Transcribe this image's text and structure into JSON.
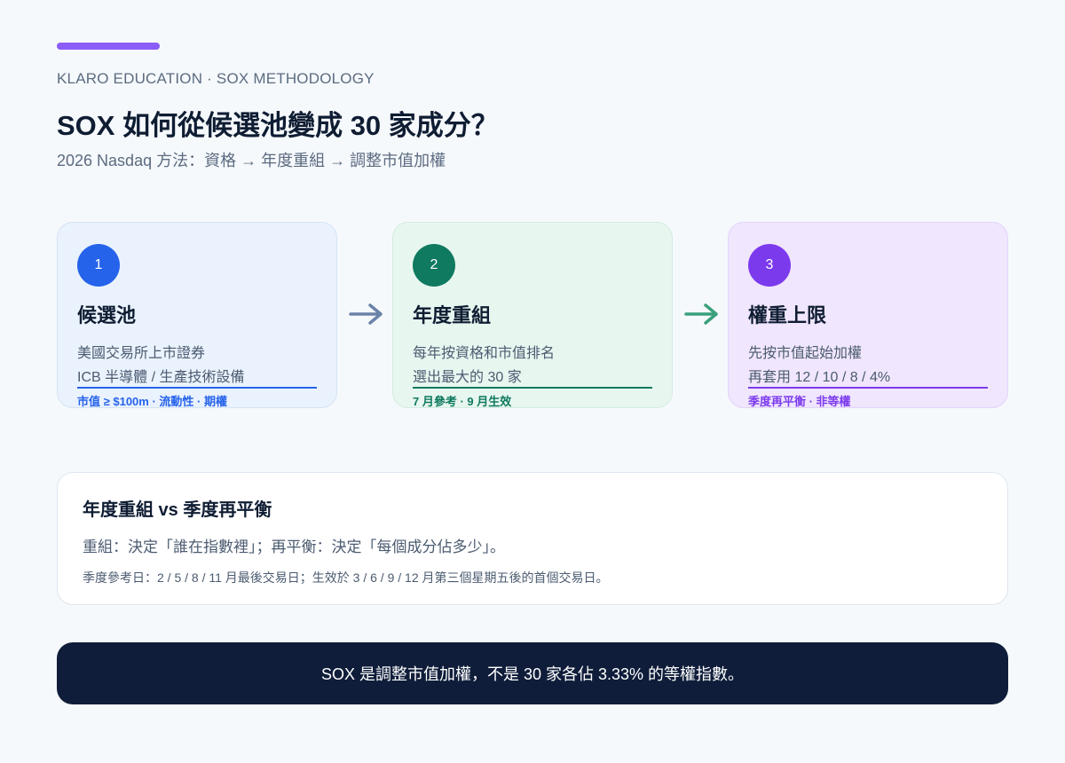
{
  "colors": {
    "background": "#f6f9fc",
    "accent_bar": "#8b5cf6",
    "step1": "#2563eb",
    "step2": "#0f7a5f",
    "step3": "#7c3aed",
    "arrow1": "#6b83a8",
    "arrow2": "#3aa07c",
    "banner": "#0f1d3a"
  },
  "header": {
    "eyebrow": "KLARO EDUCATION · SOX METHODOLOGY",
    "title": "SOX 如何從候選池變成 30 家成分？",
    "subtitle": "2026 Nasdaq 方法：資格 → 年度重組 → 調整市值加權"
  },
  "steps": [
    {
      "number": "1",
      "heading": "候選池",
      "line1": "美國交易所上市證券",
      "line2": "ICB 半導體 / 生產技術設備",
      "tag": "市值 ≥ $100m · 流動性 · 期權"
    },
    {
      "number": "2",
      "heading": "年度重組",
      "line1": "每年按資格和市值排名",
      "line2": "選出最大的 30 家",
      "tag": "7 月參考 · 9 月生效"
    },
    {
      "number": "3",
      "heading": "權重上限",
      "line1": "先按市值起始加權",
      "line2": "再套用 12 / 10 / 8 / 4%",
      "tag": "季度再平衡 · 非等權"
    }
  ],
  "arrows": [
    "arrow-right-icon",
    "arrow-right-icon"
  ],
  "comparison": {
    "title": "年度重組 vs 季度再平衡",
    "body": "重組：決定「誰在指數裡」；再平衡：決定「每個成分佔多少」。",
    "note": "季度參考日：2 / 5 / 8 / 11 月最後交易日；生效於 3 / 6 / 9 / 12 月第三個星期五後的首個交易日。"
  },
  "banner": {
    "text": "SOX 是調整市值加權，不是 30 家各佔 3.33% 的等權指數。"
  }
}
